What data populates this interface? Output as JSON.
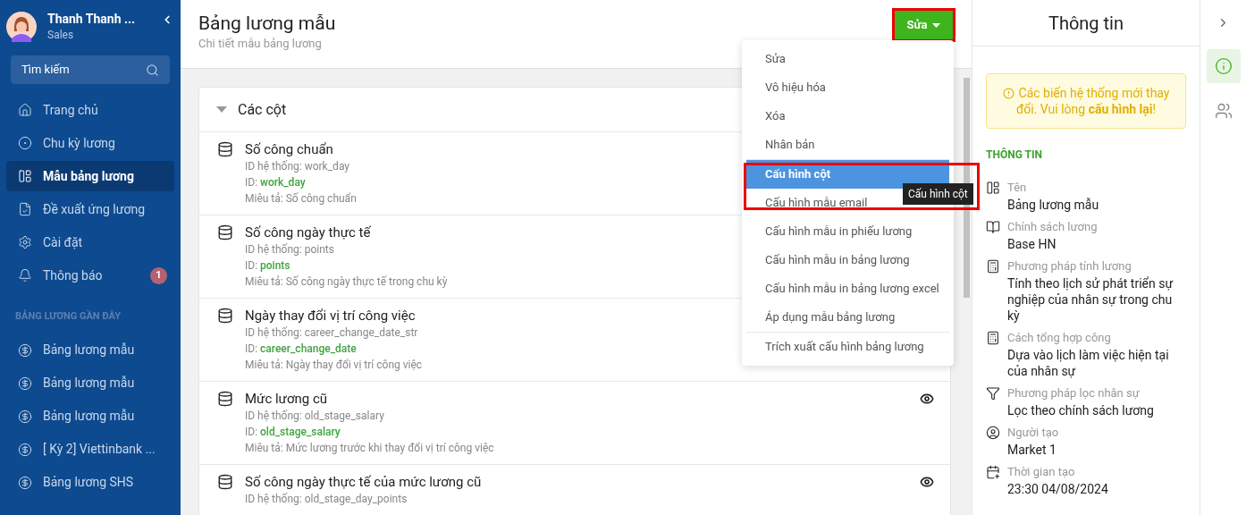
{
  "user": {
    "name": "Thanh Thanh ...",
    "role": "Sales"
  },
  "search": {
    "placeholder": "Tìm kiếm"
  },
  "nav": [
    {
      "label": "Trang chủ",
      "kind": "home",
      "selected": false
    },
    {
      "label": "Chu kỳ lương",
      "kind": "cycle",
      "selected": false
    },
    {
      "label": "Mẫu bảng lương",
      "kind": "layout",
      "selected": true
    },
    {
      "label": "Đề xuất ứng lương",
      "kind": "request",
      "selected": false
    },
    {
      "label": "Cài đặt",
      "kind": "settings",
      "selected": false
    },
    {
      "label": "Thông báo",
      "kind": "bell",
      "selected": false,
      "badge": "1"
    }
  ],
  "recent": {
    "title": "BẢNG LƯƠNG GẦN ĐÂY",
    "items": [
      "Bảng lương mẫu",
      "Bảng lương mẫu",
      "Bảng lương mẫu",
      "[ Kỳ 2] Viettinbank ...",
      "Bảng lương SHS"
    ]
  },
  "page": {
    "title": "Bảng lương mẫu",
    "subtitle": "Chi tiết mẫu bảng lương",
    "edit_button": "Sửa"
  },
  "section": {
    "title": "Các cột",
    "expanded": true
  },
  "columns": [
    {
      "name": "Số công chuẩn",
      "system_id": "ID hệ thống: work_day",
      "id_label": "ID: ",
      "id": "work_day",
      "description": "Miêu tả: Số công chuẩn"
    },
    {
      "name": "Số công ngày thực tế",
      "system_id": "ID hệ thống: points",
      "id_label": "ID: ",
      "id": "points",
      "description": "Miêu tả: Số công ngày thực tế trong chu kỳ"
    },
    {
      "name": "Ngày thay đổi vị trí công việc",
      "system_id": "ID hệ thống: career_change_date_str",
      "id_label": "ID: ",
      "id": "career_change_date",
      "description": "Miêu tả: Ngày thay đổi vị trí công việc"
    },
    {
      "name": "Mức lương cũ",
      "system_id": "ID hệ thống: old_stage_salary",
      "id_label": "ID: ",
      "id": "old_stage_salary",
      "description": "Miêu tả: Mức lương trước khi thay đổi vị trí công việc",
      "actions": [
        {
          "kind": "eye"
        }
      ]
    },
    {
      "name": "Số công ngày thực tế của mức lương cũ",
      "system_id": "ID hệ thống: old_stage_day_points",
      "actions": [
        {
          "kind": "eye"
        }
      ]
    }
  ],
  "menu": [
    {
      "label": "Sửa",
      "selected": false,
      "divider_before": false
    },
    {
      "label": "Vô hiệu hóa",
      "selected": false,
      "divider_before": false
    },
    {
      "label": "Xóa",
      "selected": false,
      "divider_before": false
    },
    {
      "label": "Nhân bản",
      "selected": false,
      "divider_before": false
    },
    {
      "label": "Cấu hình cột",
      "selected": true,
      "divider_before": true
    },
    {
      "label": "Cấu hình mẫu email",
      "selected": false,
      "divider_before": false
    },
    {
      "label": "Cấu hình mẫu in phiếu lương",
      "selected": false,
      "divider_before": false
    },
    {
      "label": "Cấu hình mẫu in bảng lương",
      "selected": false,
      "divider_before": false
    },
    {
      "label": "Cấu hình mẫu in bảng lương excel",
      "selected": false,
      "divider_before": false
    },
    {
      "label": "Áp dụng mẫu bảng lương",
      "selected": false,
      "divider_before": false
    },
    {
      "label": "Trích xuất cấu hình bảng lương",
      "selected": false,
      "divider_before": true
    }
  ],
  "tooltip": "Cấu hình cột",
  "info": {
    "title": "Thông tin",
    "warning": "Các biến hệ thống mới thay đổi. Vui lòng **cấu hình lại**!",
    "section": "THÔNG TIN",
    "fields": [
      {
        "kind": "layout",
        "label": "Tên",
        "value": "Bảng lương mẫu"
      },
      {
        "kind": "book",
        "label": "Chính sách lương",
        "value": "Base HN"
      },
      {
        "kind": "calculator",
        "label": "Phương pháp tính lương",
        "value": "Tính theo lịch sử phát triển sự nghiệp của nhân sự trong chu kỳ"
      },
      {
        "kind": "calculator",
        "label": "Cách tổng hợp công",
        "value": "Dựa vào lịch làm việc hiện tại của nhân sự"
      },
      {
        "kind": "filter",
        "label": "Phương pháp lọc nhân sự",
        "value": "Lọc theo chính sách lương"
      },
      {
        "kind": "user",
        "label": "Người tạo",
        "value": "Market 1"
      },
      {
        "kind": "calendar",
        "label": "Thời gian tạo",
        "value": "23:30 04/08/2024"
      }
    ]
  },
  "rail": [
    {
      "kind": "info",
      "selected": true
    },
    {
      "kind": "users",
      "selected": false
    }
  ]
}
